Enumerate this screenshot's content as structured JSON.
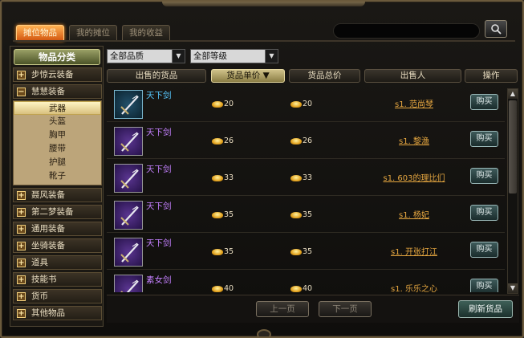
{
  "tabs": [
    {
      "label": "摊位物品",
      "active": true
    },
    {
      "label": "我的摊位",
      "active": false
    },
    {
      "label": "我的收益",
      "active": false
    }
  ],
  "search": {
    "value": "",
    "placeholder": ""
  },
  "categories": {
    "header": "物品分类",
    "items": [
      {
        "label": "步惊云装备",
        "expanded": false
      },
      {
        "label": "聂风装备",
        "expanded": false
      },
      {
        "label": "第二梦装备",
        "expanded": false
      },
      {
        "label": "通用装备",
        "expanded": false
      },
      {
        "label": "坐骑装备",
        "expanded": false
      },
      {
        "label": "道具",
        "expanded": false
      },
      {
        "label": "技能书",
        "expanded": false
      },
      {
        "label": "货币",
        "expanded": false
      },
      {
        "label": "其他物品",
        "expanded": false
      }
    ],
    "open_group": {
      "label": "慧慧装备",
      "expanded": true
    },
    "subitems": [
      "武器",
      "头盔",
      "胸甲",
      "腰带",
      "护腿",
      "靴子"
    ],
    "active_subitem": "武器"
  },
  "filters": {
    "quality": "全部品质",
    "level": "全部等级"
  },
  "columns": {
    "item": "出售的货品",
    "unit_price": "货品单价 ▼",
    "total_price": "货品总价",
    "seller": "出售人",
    "action": "操作"
  },
  "listings": [
    {
      "name": "天下剑",
      "quality": "blue",
      "unit_price": "20",
      "total_price": "20",
      "seller": "s1. 范尚琴",
      "action": "购买"
    },
    {
      "name": "天下剑",
      "quality": "purple",
      "unit_price": "26",
      "total_price": "26",
      "seller": "s1. 黎渔",
      "action": "购买"
    },
    {
      "name": "天下剑",
      "quality": "purple",
      "unit_price": "33",
      "total_price": "33",
      "seller": "s1. 603的理比们",
      "action": "购买"
    },
    {
      "name": "天下剑",
      "quality": "purple",
      "unit_price": "35",
      "total_price": "35",
      "seller": "s1. 杨妃",
      "action": "购买"
    },
    {
      "name": "天下剑",
      "quality": "purple",
      "unit_price": "35",
      "total_price": "35",
      "seller": "s1. 开张打江",
      "action": "购买"
    },
    {
      "name": "素女剑",
      "quality": "purple",
      "unit_price": "40",
      "total_price": "40",
      "seller": "s1. 乐乐之心",
      "action": "购买"
    }
  ],
  "pagination": {
    "prev": "上一页",
    "next": "下一页"
  },
  "refresh": "刷新货品",
  "colors": {
    "accent_orange": "#d45a12",
    "blue_quality": "#57c8ff",
    "purple_quality": "#c480ff",
    "seller_link": "#e6a740"
  }
}
